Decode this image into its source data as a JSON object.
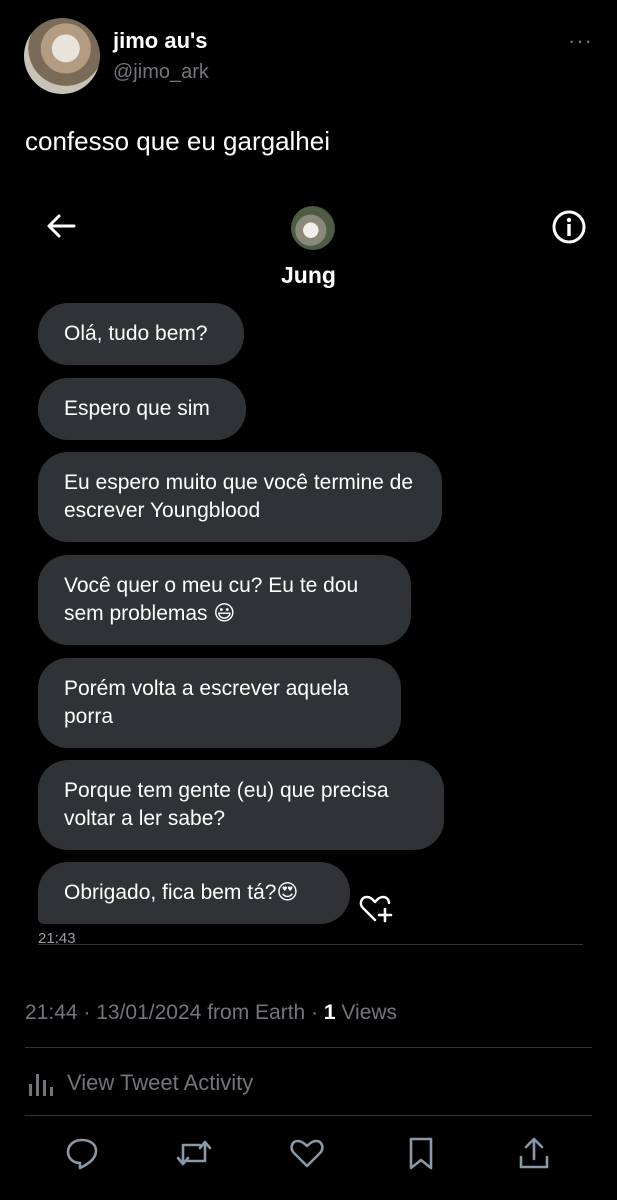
{
  "tweet": {
    "author_name": "jimo au's",
    "author_handle": "@jimo_ark",
    "more_menu": "···",
    "text": "confesso que eu gargalhei",
    "meta": {
      "time": "21:44",
      "date": "13/01/2024",
      "from": "from Earth",
      "views_count": "1",
      "views_label": "Views"
    },
    "activity_label": "View Tweet Activity"
  },
  "dm": {
    "contact_name": "Jung",
    "timestamp": "21:43",
    "messages": [
      "Olá, tudo bem?",
      "Espero que sim",
      "Eu espero muito que você termine de escrever Youngblood",
      "Você quer o meu cu? Eu te dou sem problemas 😃",
      "Porém volta a escrever aquela porra",
      "Porque tem gente (eu) que precisa voltar a ler sabe?",
      "Obrigado, fica bem tá?😍"
    ]
  },
  "icons": {
    "back": "arrow-left-icon",
    "info": "info-icon",
    "react": "heart-plus-icon",
    "activity": "bar-chart-icon",
    "reply": "reply-icon",
    "retweet": "retweet-icon",
    "like": "heart-icon",
    "bookmark": "bookmark-icon",
    "share": "share-icon"
  },
  "colors": {
    "background": "#000000",
    "bubble": "#2f3336",
    "secondary_text": "#71767b",
    "primary_text": "#ffffff"
  }
}
